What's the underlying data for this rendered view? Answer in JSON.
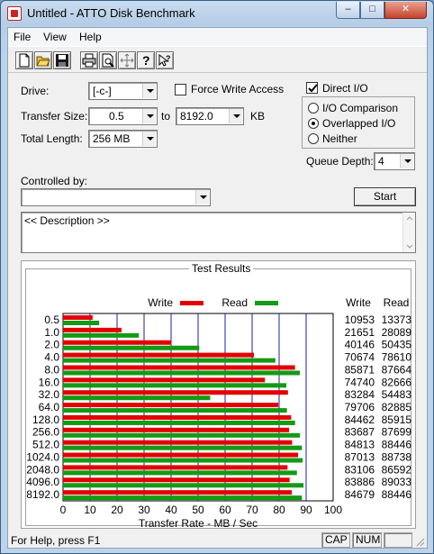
{
  "window": {
    "title": "Untitled - ATTO Disk Benchmark"
  },
  "caption_buttons": {
    "minimize": "–",
    "maximize": "□",
    "close": "✕"
  },
  "menu": [
    "File",
    "View",
    "Help"
  ],
  "toolbar": [
    "new-icon",
    "open-icon",
    "save-icon",
    "print-icon",
    "print-preview-icon",
    "move-icon",
    "help-icon",
    "context-help-icon"
  ],
  "form": {
    "drive_label": "Drive:",
    "drive_value": "[-c-]",
    "force_write_label": "Force Write Access",
    "direct_io_label": "Direct I/O",
    "transfer_size_label": "Transfer Size:",
    "transfer_from": "0.5",
    "to_label": "to",
    "transfer_to": "8192.0",
    "kb_label": "KB",
    "total_length_label": "Total Length:",
    "total_length_value": "256 MB",
    "io_comparison_label": "I/O Comparison",
    "overlapped_io_label": "Overlapped I/O",
    "neither_label": "Neither",
    "queue_depth_label": "Queue Depth:",
    "queue_depth_value": "4",
    "controlled_by_label": "Controlled by:",
    "controlled_by_value": "",
    "start_label": "Start",
    "description_text": "<< Description >>",
    "checkboxes": {
      "force_write": false,
      "direct_io": true
    },
    "selected_mode": "Overlapped I/O"
  },
  "results": {
    "group_title": "Test Results",
    "col_write": "Write",
    "col_read": "Read"
  },
  "chart_data": {
    "type": "bar",
    "orientation": "horizontal",
    "legend": [
      "Write",
      "Read"
    ],
    "legend_placement": "top",
    "xlabel": "Transfer Rate - MB / Sec",
    "xlim": [
      0,
      100
    ],
    "xticks": [
      "0",
      "10",
      "20",
      "30",
      "40",
      "50",
      "60",
      "70",
      "80",
      "90",
      "100"
    ],
    "categories": [
      "0.5",
      "1.0",
      "2.0",
      "4.0",
      "8.0",
      "16.0",
      "32.0",
      "64.0",
      "128.0",
      "256.0",
      "512.0",
      "1024.0",
      "2048.0",
      "4096.0",
      "8192.0"
    ],
    "series": [
      {
        "name": "Write",
        "color": "#e30000",
        "values": [
          10953,
          21651,
          40146,
          70674,
          85871,
          74740,
          83284,
          79706,
          84462,
          83687,
          84813,
          87013,
          83106,
          83886,
          84679
        ]
      },
      {
        "name": "Read",
        "color": "#149a14",
        "values": [
          13373,
          28089,
          50435,
          78610,
          87664,
          82666,
          54483,
          82885,
          85915,
          87699,
          88446,
          88738,
          86592,
          89033,
          88446
        ]
      }
    ],
    "grid": true
  },
  "status": {
    "help_text": "For Help, press F1",
    "cap": "CAP",
    "num": "NUM"
  }
}
